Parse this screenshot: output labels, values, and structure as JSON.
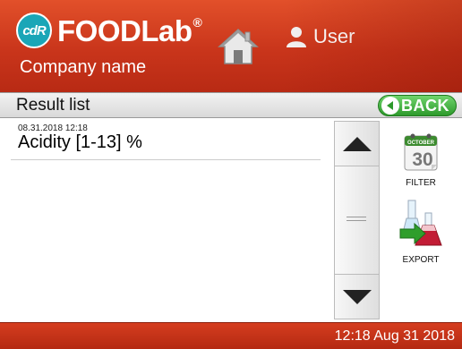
{
  "header": {
    "logo_badge": "cdR",
    "logo_text": "FOODLab",
    "logo_reg": "®",
    "company": "Company name",
    "user": "User",
    "colors": {
      "accent": "#c9351b",
      "badge": "#1aa6b7"
    }
  },
  "toolbar": {
    "title": "Result list",
    "back_label": "BACK"
  },
  "results": [
    {
      "datetime": "08.31.2018 12:18",
      "test": "Acidity [1-13] %"
    }
  ],
  "sidebar": {
    "filter_label": "FILTER",
    "calendar_month": "OCTOBER",
    "calendar_day": "30",
    "export_label": "EXPORT"
  },
  "footer": {
    "clock": "12:18  Aug 31 2018"
  },
  "icons": [
    "home-icon",
    "user-icon",
    "back-arrow-icon",
    "scroll-up-icon",
    "scroll-down-icon",
    "calendar-icon",
    "export-flask-icon"
  ]
}
